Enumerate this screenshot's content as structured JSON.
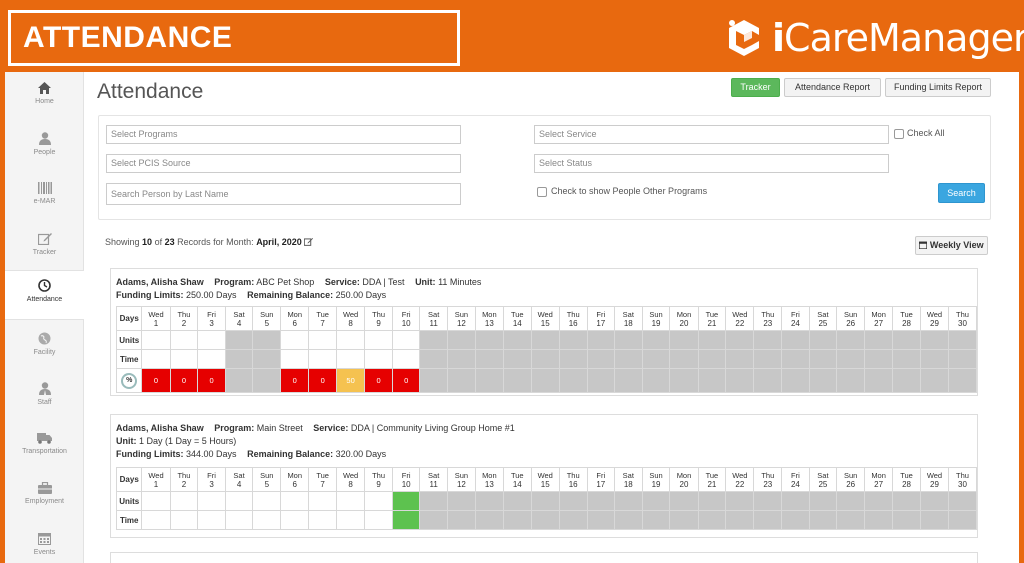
{
  "banner": {
    "title": "ATTENDANCE",
    "logo_text_bold": "i",
    "logo_text_rest": "CareManager"
  },
  "sidebar": {
    "items": [
      {
        "label": "Home",
        "icon": "home-icon"
      },
      {
        "label": "People",
        "icon": "person-icon"
      },
      {
        "label": "e-MAR",
        "icon": "barcode-icon"
      },
      {
        "label": "Tracker",
        "icon": "edit-icon"
      },
      {
        "label": "Attendance",
        "icon": "clock-icon"
      },
      {
        "label": "Facility",
        "icon": "globe-icon"
      },
      {
        "label": "Staff",
        "icon": "staff-icon"
      },
      {
        "label": "Transportation",
        "icon": "truck-icon"
      },
      {
        "label": "Employment",
        "icon": "briefcase-icon"
      },
      {
        "label": "Events",
        "icon": "calendar-icon"
      }
    ],
    "active": "Attendance"
  },
  "header": {
    "title": "Attendance",
    "tracker_btn": "Tracker",
    "report_btn": "Attendance Report",
    "funding_btn": "Funding Limits Report"
  },
  "filters": {
    "programs_placeholder": "Select Programs",
    "pcis_placeholder": "Select PCIS Source",
    "lastname_placeholder": "Search Person by Last Name",
    "service_placeholder": "Select Service",
    "status_placeholder": "Select Status",
    "check_all_label": "Check All",
    "other_programs_label": "Check to show People Other Programs",
    "search_btn": "Search"
  },
  "summary": {
    "prefix": "Showing",
    "shown": "10",
    "of": "of",
    "total": "23",
    "suffix": "Records for Month:",
    "month": "April, 2020",
    "weekly_btn": "Weekly View"
  },
  "calendar": {
    "weekdays": [
      "Wed",
      "Thu",
      "Fri",
      "Sat",
      "Sun",
      "Mon",
      "Tue",
      "Wed",
      "Thu",
      "Fri",
      "Sat",
      "Sun",
      "Mon",
      "Tue",
      "Wed",
      "Thu",
      "Fri",
      "Sat",
      "Sun",
      "Mon",
      "Tue",
      "Wed",
      "Thu",
      "Fri",
      "Sat",
      "Sun",
      "Mon",
      "Tue",
      "Wed",
      "Thu"
    ],
    "days": [
      "1",
      "2",
      "3",
      "4",
      "5",
      "6",
      "7",
      "8",
      "9",
      "10",
      "11",
      "12",
      "13",
      "14",
      "15",
      "16",
      "17",
      "18",
      "19",
      "20",
      "21",
      "22",
      "23",
      "24",
      "25",
      "26",
      "27",
      "28",
      "29",
      "30"
    ],
    "row_labels": {
      "days": "Days",
      "units": "Units",
      "time": "Time"
    },
    "pct_label": "%"
  },
  "records": [
    {
      "line1": [
        {
          "label": "",
          "value": "Adams, Alisha Shaw"
        },
        {
          "label": "Program:",
          "value": "ABC Pet Shop"
        },
        {
          "label": "Service:",
          "value": "DDA | Test"
        },
        {
          "label": "Unit:",
          "value": "11 Minutes"
        }
      ],
      "line2": [
        {
          "label": "Funding Limits:",
          "value": "250.00 Days"
        },
        {
          "label": "Remaining Balance:",
          "value": "250.00 Days"
        }
      ],
      "grey_from_day": 11,
      "grey_weekend_days": [
        4,
        5
      ],
      "status_row": [
        "0",
        "0",
        "0",
        "",
        "",
        "0",
        "0",
        "50",
        "0",
        "0"
      ],
      "status_colors": [
        "red",
        "red",
        "red",
        "grey",
        "grey",
        "red",
        "red",
        "yellow",
        "red",
        "red"
      ]
    },
    {
      "line1": [
        {
          "label": "",
          "value": "Adams, Alisha Shaw"
        },
        {
          "label": "Program:",
          "value": "Main Street"
        },
        {
          "label": "Service:",
          "value": "DDA | Community Living Group Home #1"
        }
      ],
      "line1b": [
        {
          "label": "Unit:",
          "value": "1 Day (1 Day = 5 Hours)"
        }
      ],
      "line2": [
        {
          "label": "Funding Limits:",
          "value": "344.00 Days"
        },
        {
          "label": "Remaining Balance:",
          "value": "320.00 Days"
        }
      ],
      "grey_from_day": 11,
      "green_day": 10
    }
  ],
  "colors": {
    "brand_orange": "#e8690f",
    "red": "#e60000",
    "yellow": "#f5c250",
    "green": "#5dc24f",
    "grey": "#c7c7c7"
  }
}
